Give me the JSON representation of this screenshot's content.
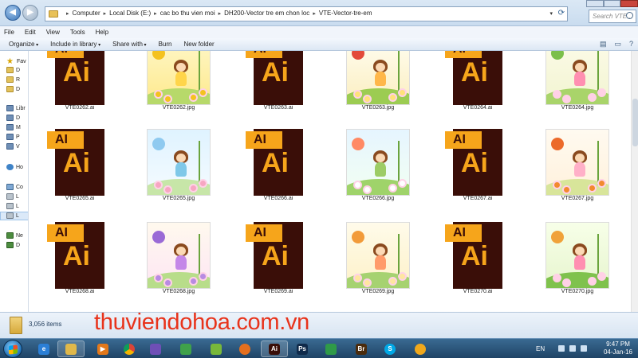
{
  "breadcrumb": [
    "Computer",
    "Local Disk (E:)",
    "cac bo thu vien moi",
    "DH200-Vector tre em chon loc",
    "VTE-Vector-tre-em"
  ],
  "search": {
    "placeholder": "Search VTE..."
  },
  "menu": [
    "File",
    "Edit",
    "View",
    "Tools",
    "Help"
  ],
  "toolbar": {
    "organize": "Organize",
    "include": "Include in library",
    "share": "Share with",
    "burn": "Burn",
    "new_folder": "New folder"
  },
  "nav": [
    {
      "label": "Fav",
      "icon": "star-icon"
    },
    {
      "label": "D",
      "icon": "folder-icon"
    },
    {
      "label": "R",
      "icon": "folder-icon"
    },
    {
      "label": "D",
      "icon": "folder-icon"
    },
    {
      "label": "Libr",
      "icon": "library-icon"
    },
    {
      "label": "D",
      "icon": "library-icon"
    },
    {
      "label": "M",
      "icon": "library-icon"
    },
    {
      "label": "P",
      "icon": "library-icon"
    },
    {
      "label": "V",
      "icon": "library-icon"
    },
    {
      "label": "Ho",
      "icon": "homegroup-icon"
    },
    {
      "label": "Co",
      "icon": "computer-icon"
    },
    {
      "label": "L",
      "icon": "disk-icon"
    },
    {
      "label": "L",
      "icon": "disk-icon"
    },
    {
      "label": "L",
      "icon": "disk-icon"
    },
    {
      "label": "Ne",
      "icon": "network-icon"
    },
    {
      "label": "D",
      "icon": "network-icon"
    }
  ],
  "files": [
    {
      "name": "VTE0262.ai",
      "type": "ai"
    },
    {
      "name": "VTE0262.jpg",
      "type": "jpg",
      "theme": "sunflower"
    },
    {
      "name": "VTE0263.ai",
      "type": "ai"
    },
    {
      "name": "VTE0263.jpg",
      "type": "jpg",
      "theme": "bird"
    },
    {
      "name": "VTE0264.ai",
      "type": "ai"
    },
    {
      "name": "VTE0264.jpg",
      "type": "jpg",
      "theme": "swing"
    },
    {
      "name": "VTE0265.ai",
      "type": "ai"
    },
    {
      "name": "VTE0265.jpg",
      "type": "jpg",
      "theme": "fairy"
    },
    {
      "name": "VTE0266.ai",
      "type": "ai"
    },
    {
      "name": "VTE0266.jpg",
      "type": "jpg",
      "theme": "rainbow"
    },
    {
      "name": "VTE0267.ai",
      "type": "ai"
    },
    {
      "name": "VTE0267.jpg",
      "type": "jpg",
      "theme": "autumn"
    },
    {
      "name": "VTE0268.ai",
      "type": "ai"
    },
    {
      "name": "VTE0268.jpg",
      "type": "jpg",
      "theme": "morningglory"
    },
    {
      "name": "VTE0269.ai",
      "type": "ai"
    },
    {
      "name": "VTE0269.jpg",
      "type": "jpg",
      "theme": "mushroom"
    },
    {
      "name": "VTE0270.ai",
      "type": "ai"
    },
    {
      "name": "VTE0270.jpg",
      "type": "jpg",
      "theme": "snail"
    }
  ],
  "ai_icon": {
    "tab_text": "AI",
    "big_text": "Ai"
  },
  "status": {
    "count": "3,056 items"
  },
  "watermark": "thuviendohoa.com.vn",
  "taskbar": {
    "apps": [
      {
        "name": "internet-explorer-icon",
        "glyph": "e",
        "color": "#2b7fd6"
      },
      {
        "name": "file-explorer-icon",
        "glyph": "",
        "color": "#e0b84a",
        "active": true
      },
      {
        "name": "media-player-icon",
        "glyph": "▶",
        "color": "#e2781b"
      },
      {
        "name": "chrome-icon",
        "glyph": "",
        "color": "#dd4b39"
      },
      {
        "name": "messenger-icon",
        "glyph": "",
        "color": "#6e4fb6"
      },
      {
        "name": "coccoc-icon",
        "glyph": "",
        "color": "#3fa14a"
      },
      {
        "name": "utorrent-icon",
        "glyph": "",
        "color": "#78b83a"
      },
      {
        "name": "firefox-icon",
        "glyph": "",
        "color": "#e46f1e"
      },
      {
        "name": "illustrator-icon",
        "glyph": "Ai",
        "color": "#3a0e08",
        "active": true
      },
      {
        "name": "photoshop-icon",
        "glyph": "Ps",
        "color": "#0f2a4a"
      },
      {
        "name": "corel-icon",
        "glyph": "",
        "color": "#2f9a48"
      },
      {
        "name": "bridge-icon",
        "glyph": "Br",
        "color": "#4a2b0c"
      },
      {
        "name": "skype-icon",
        "glyph": "S",
        "color": "#00a8e6"
      },
      {
        "name": "teamviewer-icon",
        "glyph": "",
        "color": "#f0a81c"
      }
    ],
    "lang": "EN",
    "time": "9:47 PM",
    "date": "04-Jan-16"
  }
}
